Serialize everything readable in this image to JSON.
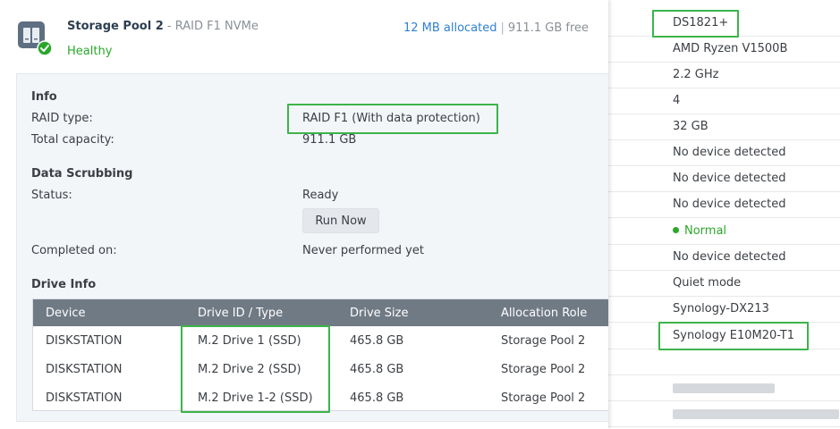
{
  "pool": {
    "name": "Storage Pool 2",
    "subtitle": "- RAID F1 NVMe",
    "status": "Healthy",
    "allocated": "12 MB allocated",
    "separator": "|",
    "free": "911.1 GB free",
    "icon": "storage-pool-icon",
    "status_icon": "check-circle-icon"
  },
  "info": {
    "title": "Info",
    "raid_type_label": "RAID type:",
    "raid_type_value": "RAID F1 (With data protection)",
    "capacity_label": "Total capacity:",
    "capacity_value": "911.1 GB"
  },
  "scrubbing": {
    "title": "Data Scrubbing",
    "status_label": "Status:",
    "status_value": "Ready",
    "run_button": "Run Now",
    "completed_label": "Completed on:",
    "completed_value": "Never performed yet"
  },
  "drive_info": {
    "title": "Drive Info",
    "columns": [
      "Device",
      "Drive ID / Type",
      "Drive Size",
      "Allocation Role"
    ],
    "rows": [
      [
        "DISKSTATION",
        "M.2 Drive 1 (SSD)",
        "465.8 GB",
        "Storage Pool 2"
      ],
      [
        "DISKSTATION",
        "M.2 Drive 2 (SSD)",
        "465.8 GB",
        "Storage Pool 2"
      ],
      [
        "DISKSTATION",
        "M.2 Drive 1-2 (SSD)",
        "465.8 GB",
        "Storage Pool 2"
      ]
    ]
  },
  "system_info": {
    "rows": [
      "DS1821+",
      "AMD Ryzen V1500B",
      "2.2 GHz",
      "4",
      "32 GB",
      "No device detected",
      "No device detected",
      "No device detected",
      "Normal",
      "No device detected",
      "Quiet mode",
      "Synology-DX213",
      "Synology E10M20-T1"
    ],
    "status_color": "#2aa72a"
  },
  "colors": {
    "highlight": "#3cb44b",
    "link": "#2f7fd1",
    "healthy": "#2aa72a",
    "table_header": "#707a85"
  }
}
